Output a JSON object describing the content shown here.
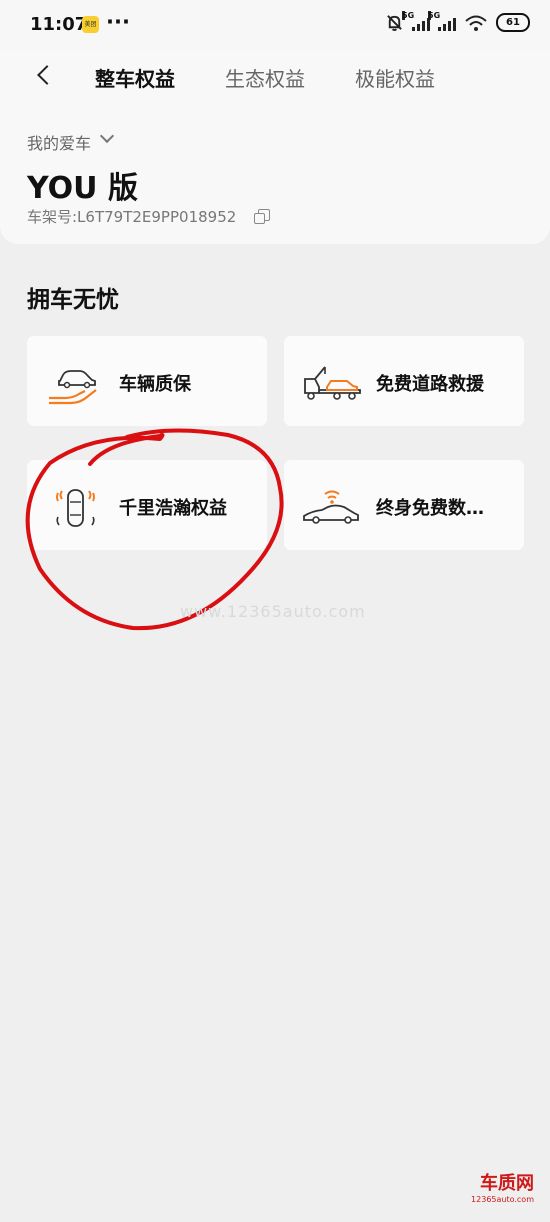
{
  "status_bar": {
    "time": "11:07",
    "app_badge": "美团",
    "more": "···",
    "signal_1_label": "5G",
    "signal_2_label": "5G",
    "battery": "61"
  },
  "header": {
    "tabs": [
      {
        "label": "整车权益",
        "active": true
      },
      {
        "label": "生态权益",
        "active": false
      },
      {
        "label": "极能权益",
        "active": false
      }
    ],
    "my_car_label": "我的爱车",
    "model": "YOU 版",
    "vin": "车架号:L6T79T2E9PP018952"
  },
  "section": {
    "title": "拥车无忧",
    "cards": [
      {
        "label": "车辆质保",
        "icon": "car-hand-icon"
      },
      {
        "label": "免费道路救援",
        "icon": "tow-truck-icon"
      },
      {
        "label": "千里浩瀚权益",
        "icon": "car-radar-icon"
      },
      {
        "label": "终身免费数…",
        "icon": "car-wifi-icon"
      }
    ]
  },
  "watermark": "www.12365auto.com",
  "logo": {
    "name": "车质网",
    "url": "12365auto.com"
  },
  "colors": {
    "accent": "#f47c20",
    "annotation": "#d90f12",
    "background": "#efefef"
  }
}
